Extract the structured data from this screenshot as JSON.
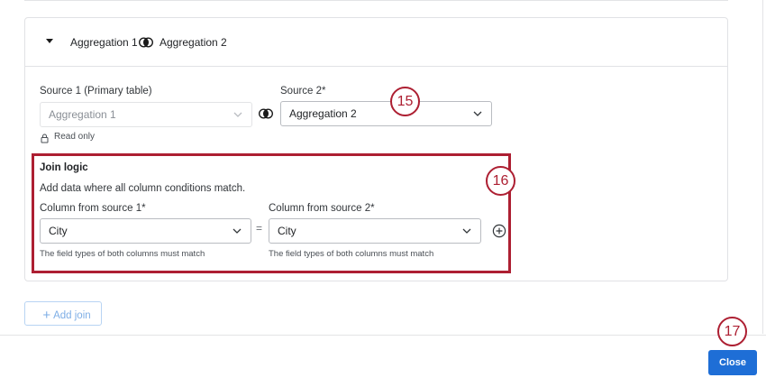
{
  "header": {
    "left_name": "Aggregation 1",
    "right_name": "Aggregation 2"
  },
  "sources": {
    "source1_label": "Source 1 (Primary table)",
    "source1_value": "Aggregation 1",
    "source2_label": "Source 2*",
    "source2_value": "Aggregation 2",
    "read_only": "Read only"
  },
  "join_logic": {
    "title": "Join logic",
    "description": "Add data where all column conditions match.",
    "col1_label": "Column from source 1*",
    "col1_value": "City",
    "col2_label": "Column from source 2*",
    "col2_value": "City",
    "equals": "=",
    "hint": "The field types of both columns must match"
  },
  "callouts": {
    "c15": "15",
    "c16": "16",
    "c17": "17"
  },
  "actions": {
    "add_join": "Add join",
    "close": "Close"
  },
  "colors": {
    "callout": "#ad1f32",
    "primary": "#1e6ed6",
    "add_join_text": "#7eaee6"
  },
  "icons": [
    "caret-down-icon",
    "inner-join-icon",
    "chevron-down-icon",
    "lock-icon",
    "plus-circle-icon",
    "plus-icon"
  ]
}
